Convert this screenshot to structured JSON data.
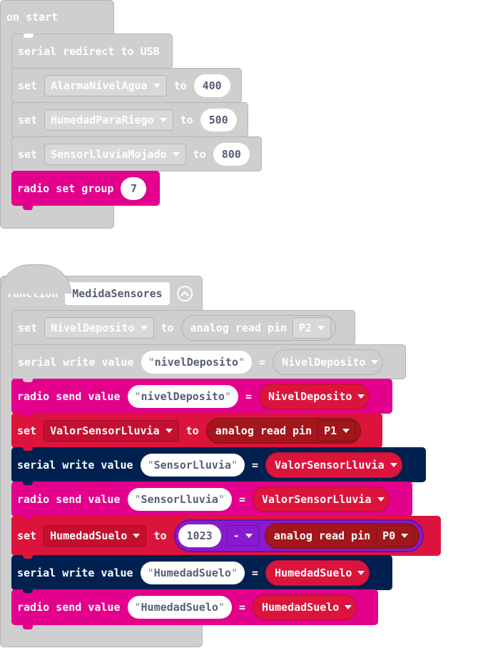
{
  "on_start": {
    "header": "on start",
    "serial_redirect": "serial redirect to USB",
    "set1": {
      "kw": "set",
      "var": "AlarmaNivelAgua",
      "to": "to",
      "value": "400"
    },
    "set2": {
      "kw": "set",
      "var": "HumedadParaRiego",
      "to": "to",
      "value": "500"
    },
    "set3": {
      "kw": "set",
      "var": "SensorLluviaMojado",
      "to": "to",
      "value": "800"
    },
    "radio_group": {
      "label": "radio set group",
      "value": "7"
    }
  },
  "function": {
    "kw": "function",
    "name": "MedidaSensores",
    "b1": {
      "kw": "set",
      "var": "NivelDeposito",
      "to": "to",
      "read": "analog read pin",
      "pin": "P2"
    },
    "b2": {
      "label": "serial write value",
      "str": "nivelDeposito",
      "eq": "=",
      "var": "NivelDeposito"
    },
    "b3": {
      "label": "radio send value",
      "str": "nivelDeposito",
      "eq": "=",
      "var": "NivelDeposito"
    },
    "b4": {
      "kw": "set",
      "var": "ValorSensorLluvia",
      "to": "to",
      "read": "analog read pin",
      "pin": "P1"
    },
    "b5": {
      "label": "serial write value",
      "str": "SensorLluvia",
      "eq": "=",
      "var": "ValorSensorLluvia"
    },
    "b6": {
      "label": "radio send value",
      "str": "SensorLluvia",
      "eq": "=",
      "var": "ValorSensorLluvia"
    },
    "b7": {
      "kw": "set",
      "var": "HumedadSuelo",
      "to": "to",
      "num": "1023",
      "op": "-",
      "read": "analog read pin",
      "pin": "P0"
    },
    "b8": {
      "label": "serial write value",
      "str": "HumedadSuelo",
      "eq": "=",
      "var": "HumedadSuelo"
    },
    "b9": {
      "label": "radio send value",
      "str": "HumedadSuelo",
      "eq": "=",
      "var": "HumedadSuelo"
    }
  },
  "colors": {
    "basic_gray": "#cfcfcf",
    "radio": "#e3008c",
    "variables": "#dc143c",
    "serial": "#002050",
    "pins": "#a3161b",
    "math": "#8a1ad0"
  }
}
